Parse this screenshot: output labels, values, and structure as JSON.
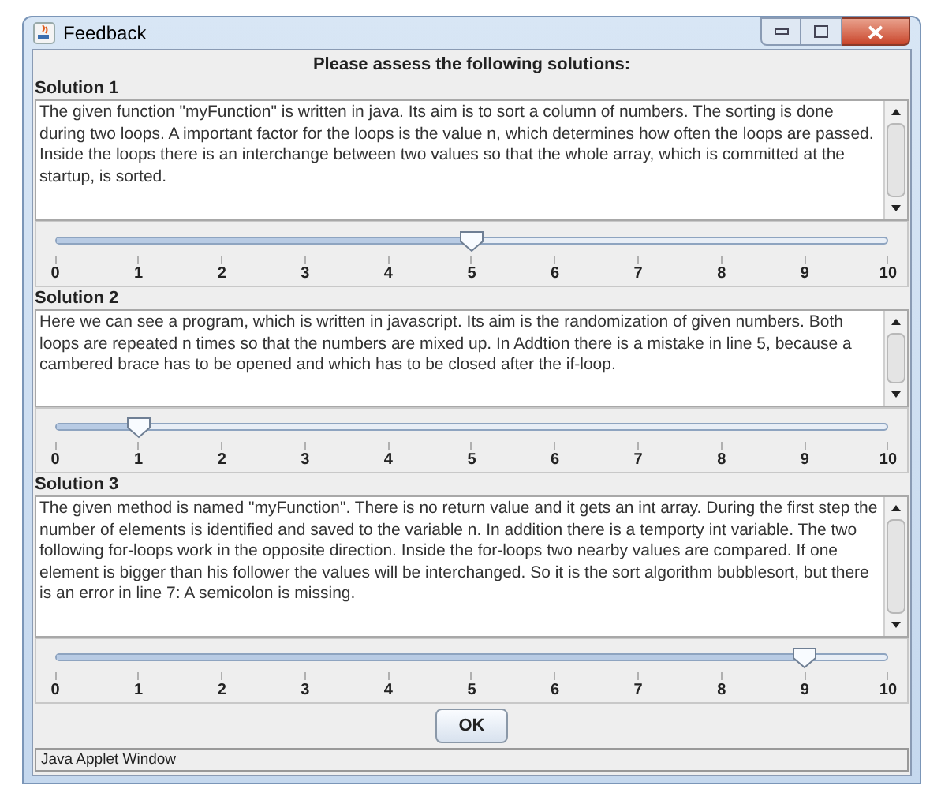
{
  "window": {
    "title": "Feedback"
  },
  "heading": "Please assess the following solutions:",
  "solutions": [
    {
      "label": "Solution 1",
      "text": "The given function \"myFunction\" is written in java. Its aim is to sort a column of numbers. The sorting is done during two loops. A important factor for the loops is the value n, which determines how often the loops are passed. Inside the loops there is an interchange between two values so that the whole array, which is committed at the startup, is sorted.",
      "level": 0.5,
      "ticks": [
        "0",
        "1",
        "2",
        "3",
        "4",
        "5",
        "6",
        "7",
        "8",
        "9",
        "10"
      ]
    },
    {
      "label": "Solution 2",
      "text": "Here we can see a program, which is written in javascript. Its aim is the randomization of given numbers. Both loops are repeated n times so that the numbers are mixed up. In Addtion there is a mistake in line 5, because a cambered brace has to be opened and which has to be closed after the if-loop.",
      "level": 0.1,
      "ticks": [
        "0",
        "1",
        "2",
        "3",
        "4",
        "5",
        "6",
        "7",
        "8",
        "9",
        "10"
      ]
    },
    {
      "label": "Solution 3",
      "text": "The given method is named \"myFunction\". There is no return value and it gets an int array. During the first step the number of elements is identified and saved to the variable n. In addition there is a temporty int variable. The two following for-loops work in the opposite direction. Inside the for-loops two nearby values are compared. If one element is bigger than his follower the values will be interchanged. So it is the sort algorithm bubblesort, but there is an error in line 7: A semicolon is missing.",
      "level": 0.9,
      "ticks": [
        "0",
        "1",
        "2",
        "3",
        "4",
        "5",
        "6",
        "7",
        "8",
        "9",
        "10"
      ]
    }
  ],
  "ok_button": "OK",
  "status_bar": "Java Applet Window"
}
